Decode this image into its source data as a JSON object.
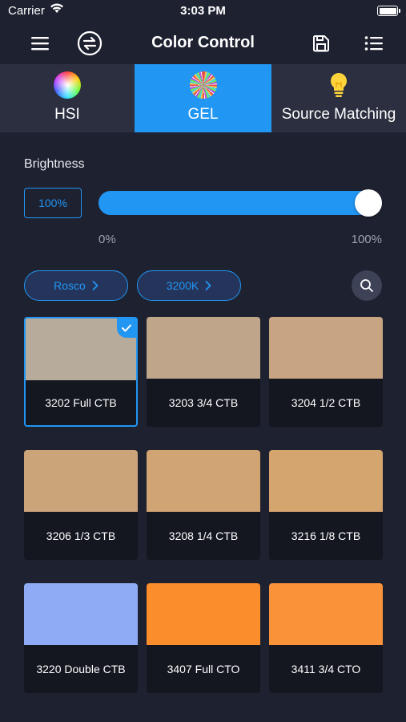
{
  "status": {
    "carrier": "Carrier",
    "time": "3:03 PM"
  },
  "nav": {
    "title": "Color Control"
  },
  "tabs": [
    {
      "label": "HSI",
      "icon": "color-wheel-icon",
      "active": false
    },
    {
      "label": "GEL",
      "icon": "gel-swatch-icon",
      "active": true
    },
    {
      "label": "Source Matching",
      "icon": "bulb-icon",
      "active": false
    }
  ],
  "brightness": {
    "label": "Brightness",
    "value_text": "100%",
    "value": 100,
    "min_label": "0%",
    "max_label": "100%"
  },
  "filters": {
    "brand": "Rosco",
    "temperature": "3200K"
  },
  "colors": {
    "accent": "#2196f3",
    "background": "#1e2130",
    "tabbar": "#2b2f3f"
  },
  "gels": [
    {
      "name": "3202 Full CTB",
      "color": "#b7ab9c",
      "selected": true
    },
    {
      "name": "3203 3/4 CTB",
      "color": "#bfa68a",
      "selected": false
    },
    {
      "name": "3204 1/2 CTB",
      "color": "#c8a582",
      "selected": false
    },
    {
      "name": "3206 1/3 CTB",
      "color": "#cca47a",
      "selected": false
    },
    {
      "name": "3208 1/4 CTB",
      "color": "#d1a474",
      "selected": false
    },
    {
      "name": "3216 1/8 CTB",
      "color": "#d5a570",
      "selected": false
    },
    {
      "name": "3220 Double CTB",
      "color": "#8fabf5",
      "selected": false
    },
    {
      "name": "3407 Full CTO",
      "color": "#fb8d2b",
      "selected": false
    },
    {
      "name": "3411 3/4 CTO",
      "color": "#f8933a",
      "selected": false
    }
  ]
}
